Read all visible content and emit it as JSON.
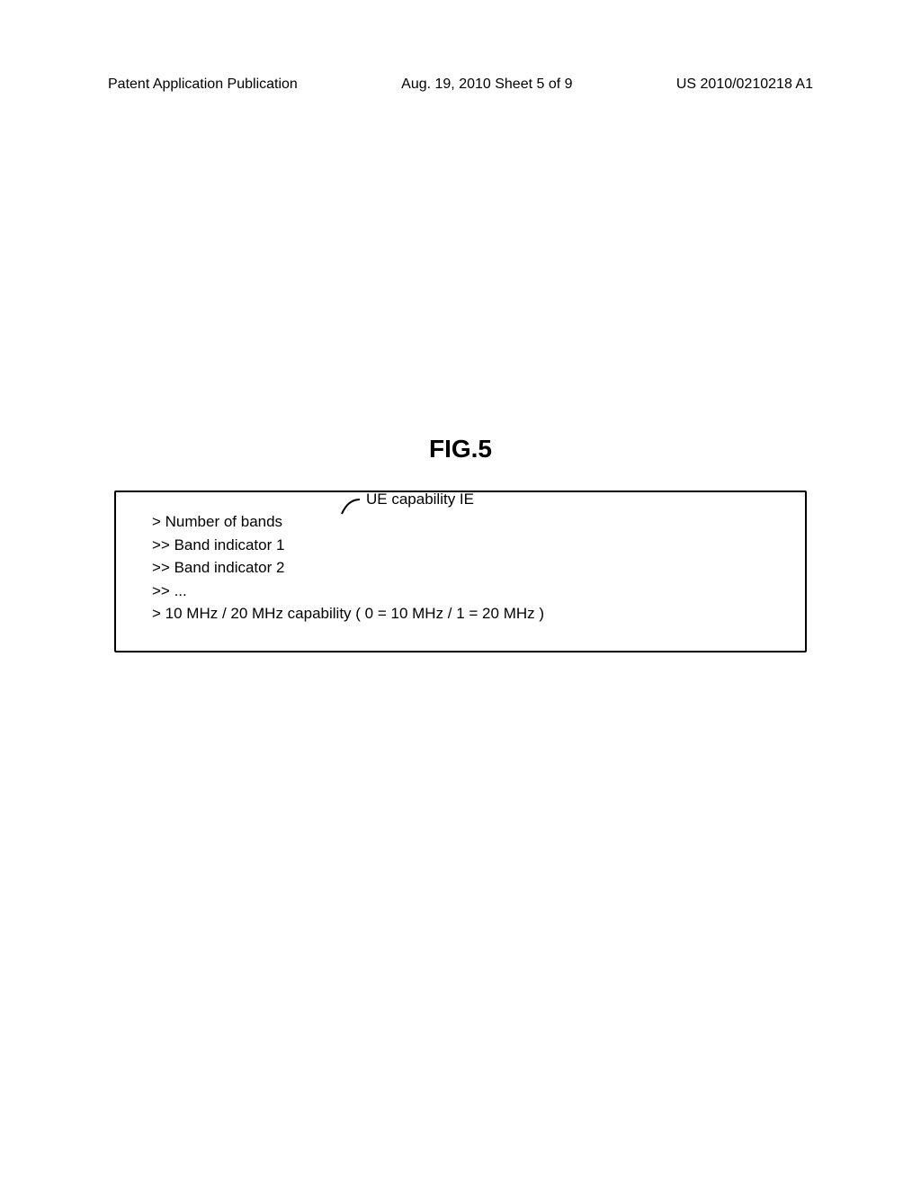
{
  "header": {
    "left": "Patent Application Publication",
    "center": "Aug. 19, 2010  Sheet 5 of 9",
    "right": "US 2010/0210218 A1"
  },
  "figure": {
    "title": "FIG.5",
    "callout_label": "UE capability IE",
    "lines": {
      "l1": "> Number of bands",
      "l2": ">> Band indicator 1",
      "l3": ">> Band indicator 2",
      "l4": ">> ...",
      "l5": "> 10 MHz / 20 MHz capability ( 0 = 10 MHz / 1 = 20 MHz )"
    }
  }
}
